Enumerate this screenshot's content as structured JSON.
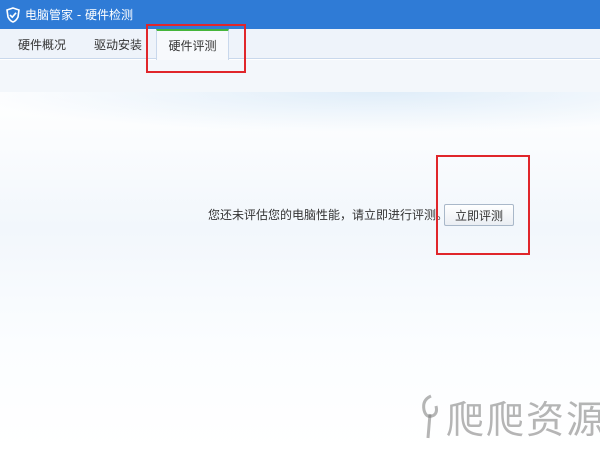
{
  "window": {
    "title": "电脑管家 - 硬件检测",
    "logo_icon": "shield-icon",
    "accent_color": "#2f7bd6"
  },
  "tabs": [
    {
      "label": "硬件概况",
      "active": false
    },
    {
      "label": "驱动安装",
      "active": false
    },
    {
      "label": "硬件评测",
      "active": true
    }
  ],
  "main": {
    "prompt_text": "您还未评估您的电脑性能，请立即进行评测。",
    "action_button_label": "立即评测"
  },
  "annotation_color": "#e0262b",
  "watermark": {
    "text": "爬爬资源"
  }
}
